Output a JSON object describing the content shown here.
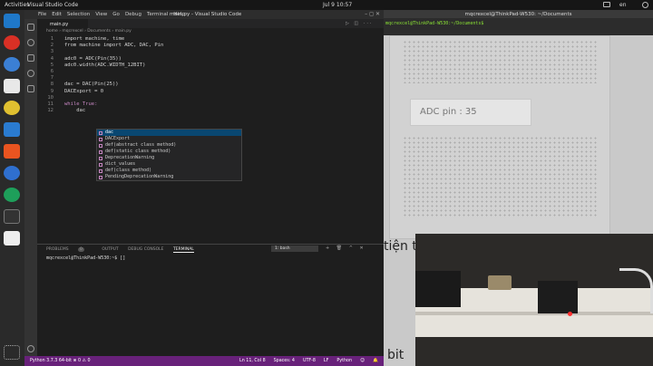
{
  "topbar": {
    "activities": "Activities",
    "app_menu": "Visual Studio Code",
    "clock": "Jul 9  10:57",
    "lang": "en"
  },
  "vscode": {
    "window_title": "main.py - Visual Studio Code",
    "menu": [
      "File",
      "Edit",
      "Selection",
      "View",
      "Go",
      "Debug",
      "Terminal",
      "Help"
    ],
    "tab": "main.py",
    "breadcrumb": "home › mqcrexcel › Documents › main.py",
    "code": [
      {
        "n": "1",
        "t": "import machine, time"
      },
      {
        "n": "2",
        "t": "from machine import ADC, DAC, Pin"
      },
      {
        "n": "3",
        "t": ""
      },
      {
        "n": "4",
        "t": "adc0 = ADC(Pin(35))"
      },
      {
        "n": "5",
        "t": "adc0.width(ADC.WIDTH_12BIT)"
      },
      {
        "n": "6",
        "t": ""
      },
      {
        "n": "7",
        "t": ""
      },
      {
        "n": "8",
        "t": "dac = DAC(Pin(25))"
      },
      {
        "n": "9",
        "t": "DACExport = 0"
      },
      {
        "n": "10",
        "t": ""
      },
      {
        "n": "11",
        "t": "while True:"
      },
      {
        "n": "12",
        "t": "    dac"
      }
    ],
    "suggestions": [
      "dac",
      "DACExport",
      "def(abstract class method)",
      "def(static class method)",
      "DeprecationWarning",
      "dict_values",
      "def(class method)",
      "PendingDeprecationWarning"
    ],
    "panel_tabs": [
      "PROBLEMS",
      "OUTPUT",
      "DEBUG CONSOLE",
      "TERMINAL"
    ],
    "problems_count": "0",
    "shell": "1: bash",
    "terminal_prompt": "mqcrexcel@ThinkPad-W530:~$ []",
    "status_left": "Python 3.7.3 64-bit  ⊗ 0 ⚠ 0",
    "status_right": [
      "Ln 11, Col 8",
      "Spaces: 4",
      "UTF-8",
      "LF",
      "Python",
      "☺",
      "🔔"
    ]
  },
  "terminal_window": {
    "title": "mqcrexcel@ThinkPad-W530: ~/Documents",
    "prompt": "mqcrexcel@ThinkPad-W530:~/Documents$"
  },
  "video": {
    "adc_label": "ADC pin : 35",
    "text1": "tiện t",
    "text2": "bit"
  }
}
